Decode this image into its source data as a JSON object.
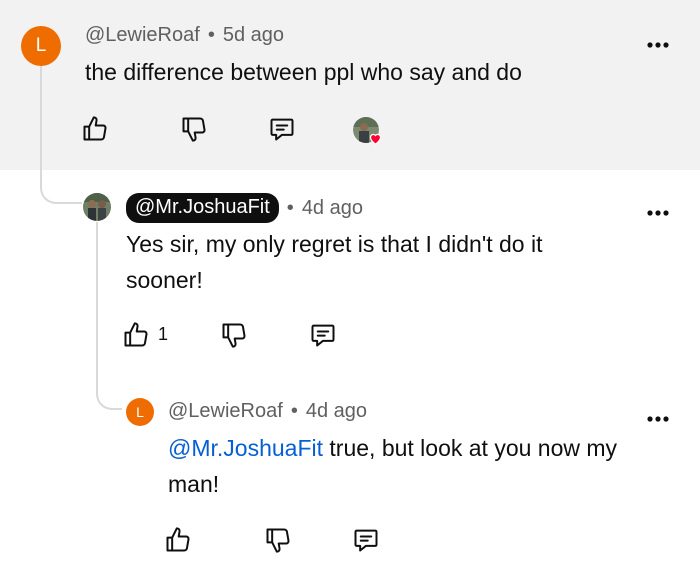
{
  "comments": [
    {
      "avatar_letter": "L",
      "author": "@LewieRoaf",
      "separator": "•",
      "time": "5d ago",
      "text": "the difference between ppl who say and do",
      "actions": {
        "like_count": ""
      }
    },
    {
      "avatar_icon": "profile-photo",
      "author": "@Mr.JoshuaFit",
      "separator": "•",
      "time": "4d ago",
      "text": "Yes sir, my only regret is that I didn't do it sooner!",
      "actions": {
        "like_count": "1"
      }
    },
    {
      "avatar_letter": "L",
      "author": "@LewieRoaf",
      "separator": "•",
      "time": "4d ago",
      "mention": "@Mr.JoshuaFit",
      "text": " true, but look at you now my man!",
      "actions": {
        "like_count": ""
      }
    }
  ],
  "colors": {
    "avatar_orange": "#ef6c00",
    "mention_blue": "#065fd4",
    "heart_red": "#ff0033",
    "highlight_bg": "#f2f2f2"
  },
  "icons": [
    "thumbs-up-icon",
    "thumbs-down-icon",
    "reply-icon",
    "more-vert-icon",
    "creator-heart-icon"
  ]
}
